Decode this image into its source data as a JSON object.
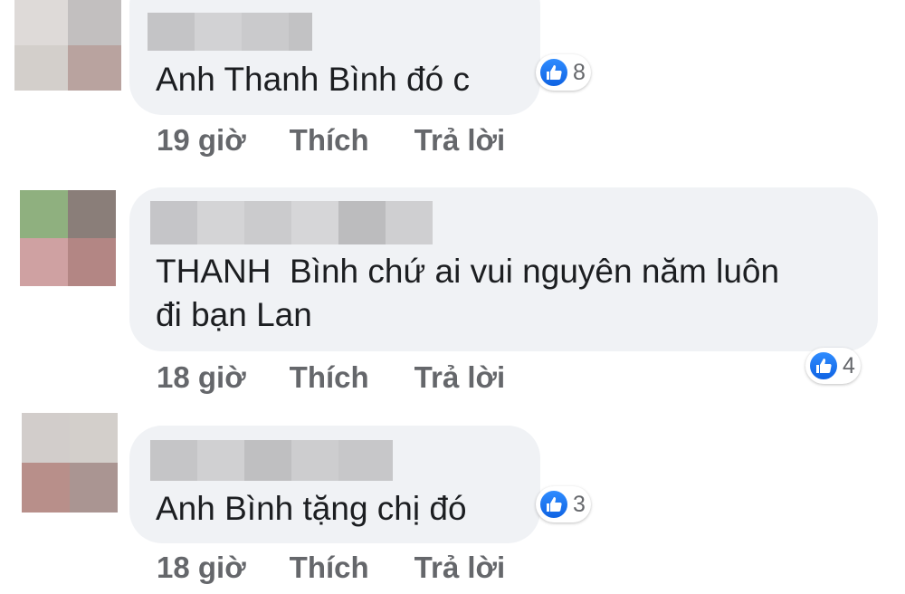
{
  "comments": [
    {
      "text": "Anh Thanh Bình đó c",
      "reactions": {
        "icon": "thumbs-up-icon",
        "count": "8"
      },
      "time": "19 giờ",
      "like_label": "Thích",
      "reply_label": "Trả lời"
    },
    {
      "text": "THANH  Bình chứ ai vui nguyên năm luôn\nđi bạn Lan",
      "reactions": {
        "icon": "thumbs-up-icon",
        "count": "4"
      },
      "time": "18 giờ",
      "like_label": "Thích",
      "reply_label": "Trả lời"
    },
    {
      "text": "Anh Bình tặng chị đó",
      "reactions": {
        "icon": "thumbs-up-icon",
        "count": "3"
      },
      "time": "18 giờ",
      "like_label": "Thích",
      "reply_label": "Trả lời"
    }
  ],
  "colors": {
    "bubble": "#f0f2f5",
    "like_blue": "#1877f2",
    "meta_text": "#65676b",
    "comment_text": "#1c1e21"
  }
}
